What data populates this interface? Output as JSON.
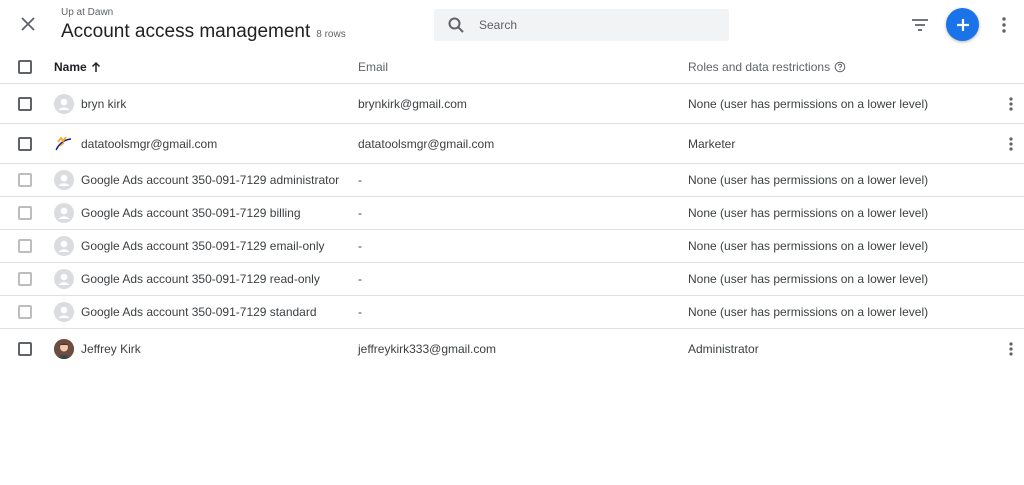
{
  "header": {
    "subtitle": "Up at Dawn",
    "title": "Account access management",
    "row_count": "8 rows",
    "search_placeholder": "Search"
  },
  "columns": {
    "name": "Name",
    "email": "Email",
    "roles": "Roles and data restrictions"
  },
  "rows": [
    {
      "name": "bryn kirk",
      "email": "brynkirk@gmail.com",
      "roles": "None (user has permissions on a lower level)",
      "avatar": "person-icon",
      "editable": true
    },
    {
      "name": "datatoolsmgr@gmail.com",
      "email": "datatoolsmgr@gmail.com",
      "roles": "Marketer",
      "avatar": "logo-icon",
      "editable": true
    },
    {
      "name": "Google Ads account 350-091-7129 administrator",
      "email": "-",
      "roles": "None (user has permissions on a lower level)",
      "avatar": "person-icon",
      "editable": false
    },
    {
      "name": "Google Ads account 350-091-7129 billing",
      "email": "-",
      "roles": "None (user has permissions on a lower level)",
      "avatar": "person-icon",
      "editable": false
    },
    {
      "name": "Google Ads account 350-091-7129 email-only",
      "email": "-",
      "roles": "None (user has permissions on a lower level)",
      "avatar": "person-icon",
      "editable": false
    },
    {
      "name": "Google Ads account 350-091-7129 read-only",
      "email": "-",
      "roles": "None (user has permissions on a lower level)",
      "avatar": "person-icon",
      "editable": false
    },
    {
      "name": "Google Ads account 350-091-7129 standard",
      "email": "-",
      "roles": "None (user has permissions on a lower level)",
      "avatar": "person-icon",
      "editable": false
    },
    {
      "name": "Jeffrey Kirk",
      "email": "jeffreykirk333@gmail.com",
      "roles": "Administrator",
      "avatar": "photo-icon",
      "editable": true
    }
  ],
  "colors": {
    "accent": "#1a73e8",
    "divider": "#e0e0e0",
    "search_bg": "#f1f3f4"
  }
}
